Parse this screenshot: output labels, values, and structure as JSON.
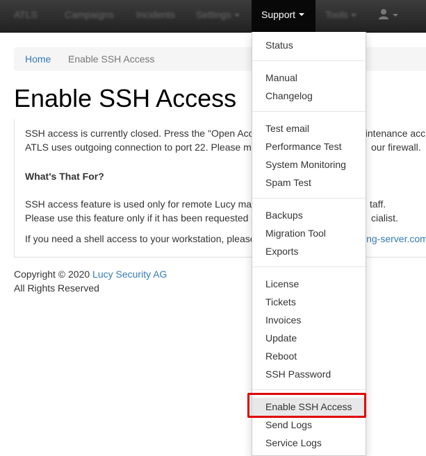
{
  "navbar": {
    "brand": "ATLS",
    "items": [
      {
        "label": "Campaigns"
      },
      {
        "label": "Incidents"
      },
      {
        "label": "Settings"
      },
      {
        "label": "Support"
      },
      {
        "label": "Tools"
      }
    ]
  },
  "breadcrumb": {
    "home": "Home",
    "separator": "/",
    "current": "Enable SSH Access"
  },
  "page": {
    "title": "Enable SSH Access",
    "line1": "SSH access is currently closed. Press the \"Open Acc",
    "line1b": "aintenance acc",
    "line2": "ATLS uses outgoing connection to port 22. Please m",
    "line2b": "our firewall.",
    "heading": "What's That For?",
    "line3": "SSH access feature is used only for remote Lucy ma",
    "line3b": "taff.",
    "line4": "Please use this feature only if it has been requested",
    "line4b": "cialist.",
    "line5": "If you need a shell access to your workstation, please",
    "line5b": "ing-server.com"
  },
  "footer": {
    "copyright": "Copyright © 2020",
    "company": "Lucy Security AG",
    "rights": "All Rights Reserved"
  },
  "dropdown": {
    "groups": [
      [
        "Status"
      ],
      [
        "Manual",
        "Changelog"
      ],
      [
        "Test email",
        "Performance Test",
        "System Monitoring",
        "Spam Test"
      ],
      [
        "Backups",
        "Migration Tool",
        "Exports"
      ],
      [
        "License",
        "Tickets",
        "Invoices",
        "Update",
        "Reboot",
        "SSH Password"
      ],
      [
        "Enable SSH Access",
        "Send Logs",
        "Service Logs"
      ]
    ]
  }
}
